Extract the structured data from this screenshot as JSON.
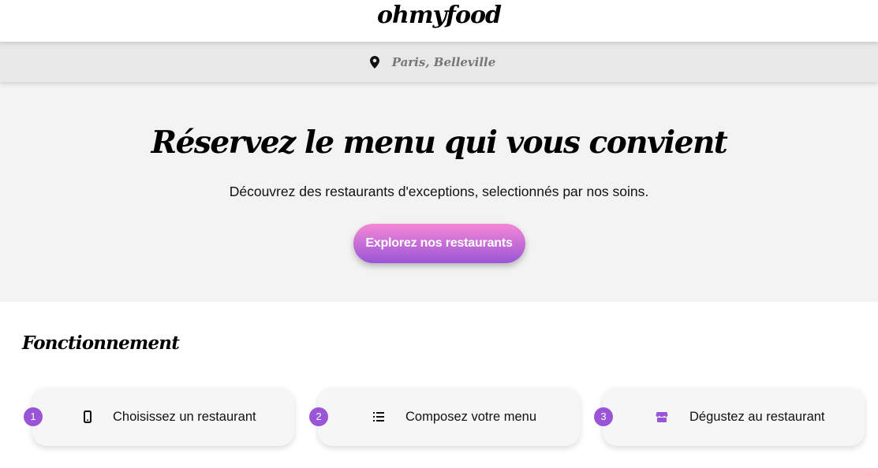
{
  "header": {
    "logo": "ohmyfood"
  },
  "location": {
    "icon": "map-pin-icon",
    "text": "Paris, Belleville"
  },
  "hero": {
    "title": "Réservez le menu qui vous convient",
    "subtitle": "Découvrez des restaurants d'exceptions, selectionnés par nos soins.",
    "cta_label": "Explorez nos restaurants"
  },
  "how_it_works": {
    "title": "Fonctionnement",
    "steps": [
      {
        "number": "1",
        "icon": "mobile-phone-icon",
        "label": "Choisissez un restaurant"
      },
      {
        "number": "2",
        "icon": "list-icon",
        "label": "Composez votre menu"
      },
      {
        "number": "3",
        "icon": "store-icon",
        "label": "Dégustez au restaurant"
      }
    ]
  },
  "colors": {
    "accent": "#9a55d6",
    "accent_light": "#f588d6"
  }
}
